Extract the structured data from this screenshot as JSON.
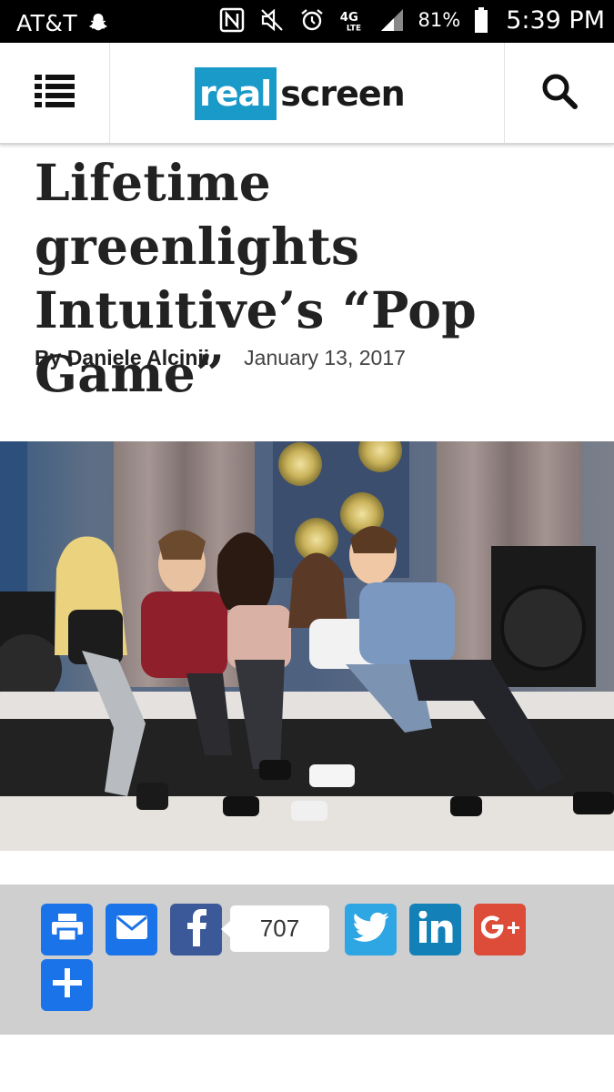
{
  "status_bar": {
    "carrier": "AT&T",
    "network": "4G LTE",
    "battery": "81%",
    "time": "5:39 PM",
    "icons": [
      "snapchat-icon",
      "nfc-icon",
      "mute-icon",
      "alarm-icon",
      "lte-icon",
      "signal-icon",
      "battery-icon"
    ]
  },
  "header": {
    "menu_icon": "list-menu-icon",
    "logo_part1": "real",
    "logo_part2": "screen",
    "search_icon": "search-icon",
    "brand_color": "#1a9ac9"
  },
  "article": {
    "headline": "Lifetime greenlights Intuitive’s “Pop Game”",
    "author": "By Daniele Alcinii",
    "date": "January 13, 2017"
  },
  "share": {
    "count": "707",
    "buttons": [
      {
        "name": "print",
        "color": "#1a73e8",
        "icon": "printer-icon"
      },
      {
        "name": "email",
        "color": "#1a73e8",
        "icon": "envelope-icon"
      },
      {
        "name": "facebook",
        "color": "#3b5998",
        "icon": "facebook-icon"
      },
      {
        "name": "twitter",
        "color": "#2ea6e3",
        "icon": "twitter-icon"
      },
      {
        "name": "linkedin",
        "color": "#1380b8",
        "icon": "linkedin-icon"
      },
      {
        "name": "google-plus",
        "color": "#dd4b39",
        "icon": "google-plus-icon"
      },
      {
        "name": "more",
        "color": "#1a73e8",
        "icon": "plus-icon"
      }
    ]
  }
}
